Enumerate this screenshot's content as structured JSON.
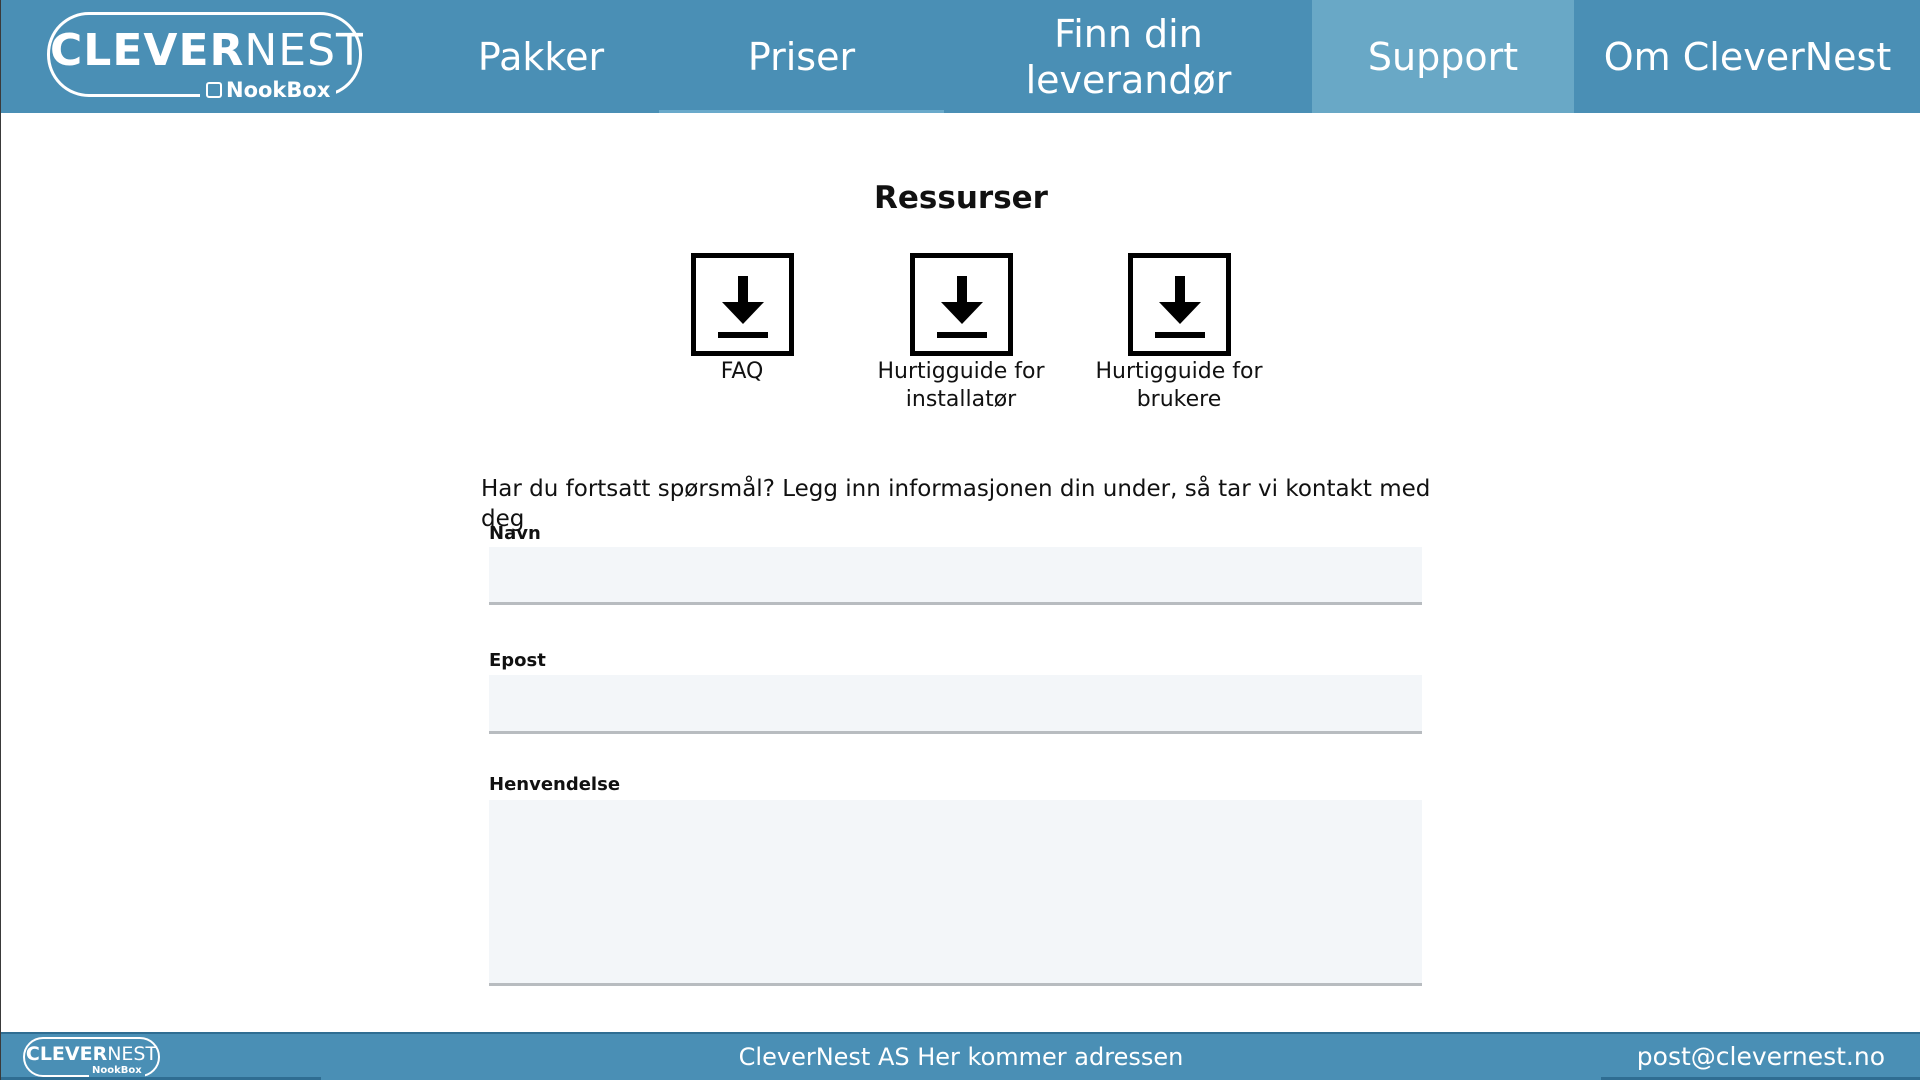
{
  "header": {
    "logo": {
      "brand_bold": "CLEVER",
      "brand_light": "NEST",
      "sub": "NookBox"
    },
    "nav": {
      "pakker": "Pakker",
      "priser": "Priser",
      "finn_line1": "Finn din",
      "finn_line2": "leverandør",
      "support": "Support",
      "om": "Om CleverNest"
    },
    "active_item": "Support"
  },
  "main": {
    "section_title": "Ressurser",
    "resources": [
      {
        "label_line1": "FAQ",
        "label_line2": "",
        "icon": "download-icon"
      },
      {
        "label_line1": "Hurtigguide for",
        "label_line2": "installatør",
        "icon": "download-icon"
      },
      {
        "label_line1": "Hurtigguide for",
        "label_line2": "brukere",
        "icon": "download-icon"
      }
    ],
    "intro": "Har du fortsatt spørsmål? Legg inn informasjonen din under, så tar vi kontakt med deg",
    "form": {
      "navn_label": "Navn",
      "navn_value": "",
      "epost_label": "Epost",
      "epost_value": "",
      "henvendelse_label": "Henvendelse",
      "henvendelse_value": ""
    }
  },
  "footer": {
    "logo": {
      "brand_bold": "CLEVER",
      "brand_light": "NEST",
      "sub": "NookBox"
    },
    "address": "CleverNest AS Her kommer adressen",
    "email": "post@clevernest.no"
  },
  "colors": {
    "header_bg": "#4a8fb5",
    "active_nav_bg": "#69a8c6",
    "field_bg": "#f3f6f9",
    "field_border": "#b8bcc0"
  }
}
